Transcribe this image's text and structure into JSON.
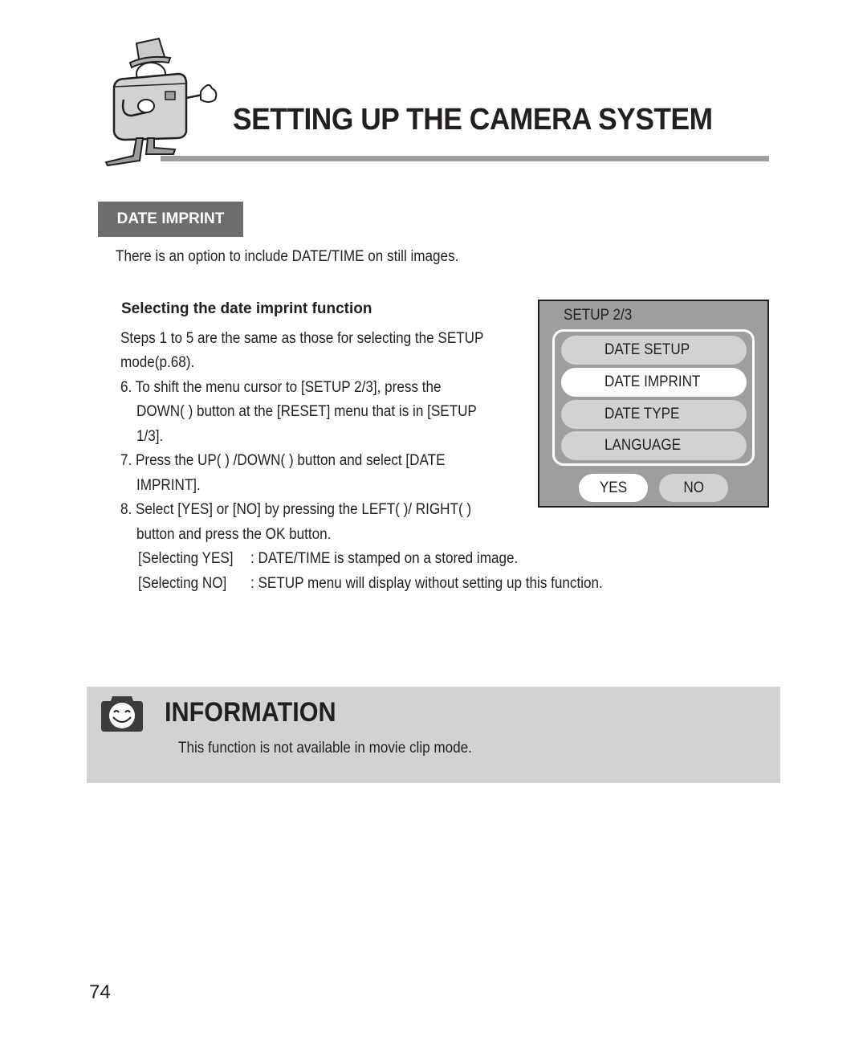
{
  "header": {
    "title": "SETTING UP THE CAMERA SYSTEM",
    "mascot": "camera-mascot-illustration"
  },
  "section": {
    "badge": "DATE IMPRINT",
    "intro": "There is an option to include DATE/TIME on still images.",
    "sub_heading": "Selecting the date imprint function",
    "lines": [
      "Steps 1 to 5 are the same as those for selecting the SETUP",
      "mode(p.68).",
      "6. To shift the menu cursor to [SETUP 2/3], press the",
      "DOWN(    ) button at the [RESET] menu that is in [SETUP",
      "1/3].",
      "7. Press the UP(    ) /DOWN(    ) button and select [DATE",
      "IMPRINT].",
      "8. Select [YES] or [NO] by pressing the LEFT(    )/ RIGHT(    )",
      "button and press the OK button."
    ],
    "options": [
      {
        "label": "[Selecting YES]",
        "desc": ": DATE/TIME is stamped on a stored image."
      },
      {
        "label": "[Selecting NO]",
        "desc": ": SETUP menu will display without setting up this function."
      }
    ]
  },
  "lcd": {
    "title": "SETUP 2/3",
    "items": [
      {
        "label": "DATE SETUP",
        "selected": false
      },
      {
        "label": "DATE IMPRINT",
        "selected": true
      },
      {
        "label": "DATE TYPE",
        "selected": false
      },
      {
        "label": "LANGUAGE",
        "selected": false
      }
    ],
    "yes": "YES",
    "no": "NO",
    "selected_choice": "YES"
  },
  "information": {
    "title": "INFORMATION",
    "icon": "smiling-camera-icon",
    "text": "This function is not available in movie clip mode."
  },
  "page_number": "74",
  "colors": {
    "badge_bg": "#6d6e70",
    "rule": "#9d9e9f",
    "lcd_bg": "#9d9e9f",
    "info_bg": "#d1d2d4",
    "text": "#231f20"
  }
}
